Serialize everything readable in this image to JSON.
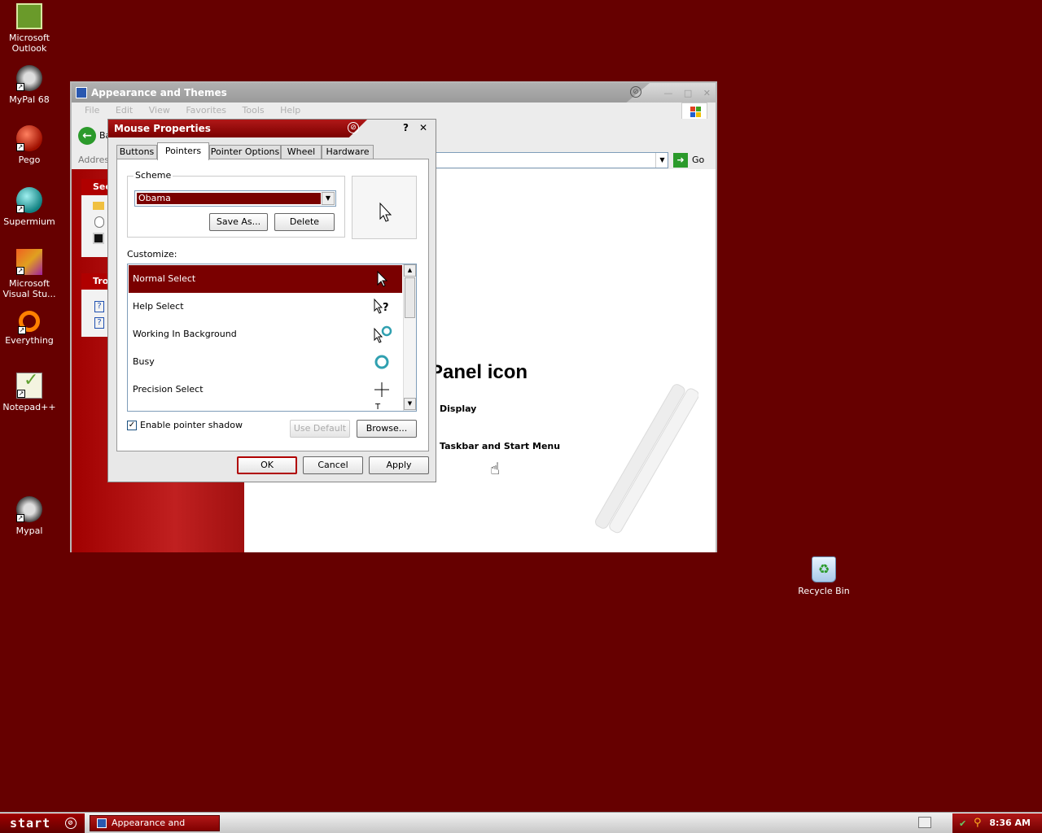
{
  "desktop": {
    "icons": [
      {
        "label": "Microsoft Outlook",
        "icon": "outlook-icon",
        "color": "#6a9a2a"
      },
      {
        "label": "MyPal 68",
        "icon": "raccoon-icon",
        "color": "#444444"
      },
      {
        "label": "Pego",
        "icon": "red-sphere-icon",
        "color": "#c02000"
      },
      {
        "label": "Supermium",
        "icon": "globe-icon",
        "color": "#20a0a0"
      },
      {
        "label": "Microsoft Visual Stu...",
        "icon": "visual-studio-icon",
        "color": "#e05020"
      },
      {
        "label": "Everything",
        "icon": "everything-icon",
        "color": "#ff8000"
      },
      {
        "label": "Notepad++",
        "icon": "notepadpp-icon",
        "color": "#60a030"
      },
      {
        "label": "Mypal",
        "icon": "raccoon-icon",
        "color": "#444444"
      }
    ],
    "recycle_bin": "Recycle Bin"
  },
  "explorer": {
    "title": "Appearance and Themes",
    "menu": [
      "File",
      "Edit",
      "View",
      "Favorites",
      "Tools",
      "Help"
    ],
    "back_label": "Ba",
    "address_label": "Address",
    "go_label": "Go",
    "side_headers": [
      "See",
      "Tro"
    ],
    "main_title_fragment": "Panel icon",
    "links": [
      "Display",
      "Taskbar and Start Menu"
    ]
  },
  "dialog": {
    "title": "Mouse Properties",
    "help": "?",
    "close": "✕",
    "tabs": [
      "Buttons",
      "Pointers",
      "Pointer Options",
      "Wheel",
      "Hardware"
    ],
    "active_tab": "Pointers",
    "scheme_legend": "Scheme",
    "scheme_value": "Obama",
    "save_as": "Save As...",
    "delete": "Delete",
    "customize_label": "Customize:",
    "pointers": [
      {
        "name": "Normal Select",
        "glyph": "➤",
        "selected": true
      },
      {
        "name": "Help Select",
        "glyph": "?",
        "selected": false
      },
      {
        "name": "Working In Background",
        "glyph": "◌",
        "selected": false
      },
      {
        "name": "Busy",
        "glyph": "◯",
        "selected": false
      },
      {
        "name": "Precision Select",
        "glyph": "+",
        "selected": false
      }
    ],
    "enable_shadow": "Enable pointer shadow",
    "shadow_checked": true,
    "use_default": "Use Default",
    "browse": "Browse...",
    "ok": "OK",
    "cancel": "Cancel",
    "apply": "Apply"
  },
  "taskbar": {
    "start": "start",
    "task": "Appearance and Themes",
    "time": "8:36 AM"
  },
  "colors": {
    "desktop": "#660000",
    "accent": "#7a0000"
  }
}
